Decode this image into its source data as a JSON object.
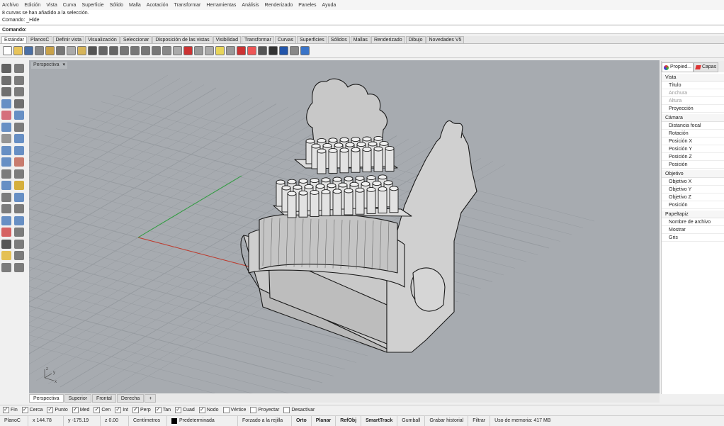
{
  "menu": [
    "Archivo",
    "Edición",
    "Vista",
    "Curva",
    "Superficie",
    "Sólido",
    "Malla",
    "Acotación",
    "Transformar",
    "Herramientas",
    "Análisis",
    "Renderizado",
    "Paneles",
    "Ayuda"
  ],
  "command_history": [
    "8 curvas se han añadido a la selección.",
    "Comando: _Hide"
  ],
  "command_prompt": "Comando:",
  "toolbar_tabs": [
    "Estándar",
    "PlanosC",
    "Definir vista",
    "Visualización",
    "Seleccionar",
    "Disposición de las vistas",
    "Visibilidad",
    "Transformar",
    "Curvas",
    "Superficies",
    "Sólidos",
    "Mallas",
    "Renderizado",
    "Dibujo",
    "Novedades V5"
  ],
  "viewport_label": "Perspectiva",
  "viewport_tabs": [
    "Perspectiva",
    "Superior",
    "Frontal",
    "Derecha",
    "+"
  ],
  "osnaps": [
    {
      "label": "Fin",
      "checked": true
    },
    {
      "label": "Cerca",
      "checked": true
    },
    {
      "label": "Punto",
      "checked": true
    },
    {
      "label": "Med",
      "checked": true
    },
    {
      "label": "Cen",
      "checked": true
    },
    {
      "label": "Int",
      "checked": true
    },
    {
      "label": "Perp",
      "checked": true
    },
    {
      "label": "Tan",
      "checked": true
    },
    {
      "label": "Cuad",
      "checked": true
    },
    {
      "label": "Nodo",
      "checked": true
    },
    {
      "label": "Vértice",
      "checked": false
    },
    {
      "label": "Proyectar",
      "checked": false
    },
    {
      "label": "Desactivar",
      "checked": false
    }
  ],
  "status": {
    "cplane": "PlanoC",
    "x": "x 144.78",
    "y": "y -175.19",
    "z": "z 0.00",
    "units": "Centímetros",
    "layer": "Predeterminada",
    "grid_snap": "Forzado a la rejilla",
    "ortho": "Orto",
    "planar": "Planar",
    "osnap": "RefObj",
    "smarttrack": "SmartTrack",
    "gumball": "Gumball",
    "history": "Grabar historial",
    "filter": "Filtrar",
    "memory": "Uso de memoria: 417 MB"
  },
  "panel": {
    "tab_properties": "Propied...",
    "tab_layers": "Capas",
    "sections": [
      {
        "title": "Vista",
        "items": [
          "Título",
          "Anchura",
          "Altura",
          "Proyección"
        ],
        "dim": [
          1,
          2
        ]
      },
      {
        "title": "Cámara",
        "items": [
          "Distancia focal",
          "Rotación",
          "Posición X",
          "Posición Y",
          "Posición Z",
          "Posición"
        ],
        "dim": []
      },
      {
        "title": "Objetivo",
        "items": [
          "Objetivo X",
          "Objetivo Y",
          "Objetivo Z",
          "Posición"
        ],
        "dim": []
      },
      {
        "title": "Papeltapiz",
        "items": [
          "Nombre de archivo",
          "Mostrar",
          "Gris"
        ],
        "dim": []
      }
    ]
  },
  "colors": {
    "viewport_bg": "#a7abb0",
    "grid": "#959a9f",
    "x_axis": "#c0392b",
    "y_axis": "#2e9e3e",
    "model_face": "#d6d6d6",
    "model_edge": "#1a1a1a"
  }
}
